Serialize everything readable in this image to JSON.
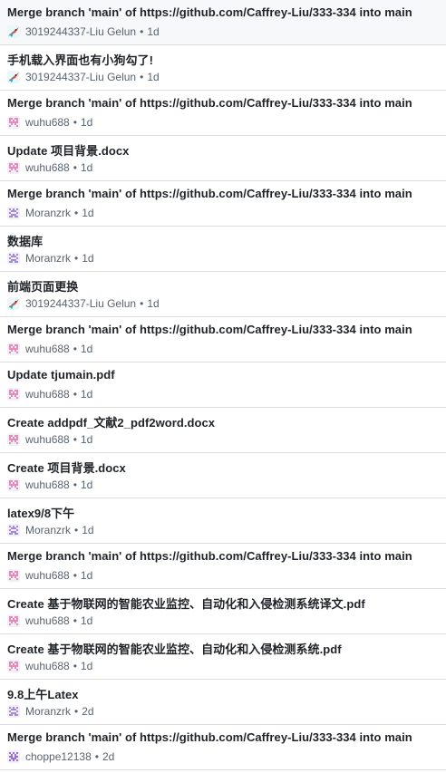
{
  "commits": [
    {
      "message": "Merge branch 'main' of https://github.com/Caffrey-Liu/333-334 into main",
      "author": "3019244337-Liu Gelun",
      "age": "1d",
      "avatar": "bird-avatar-icon",
      "sep": "•"
    },
    {
      "message": "手机载入界面也有小狗勾了!",
      "author": "3019244337-Liu Gelun",
      "age": "1d",
      "avatar": "bird-avatar-icon",
      "sep": "•"
    },
    {
      "message": "Merge branch 'main' of https://github.com/Caffrey-Liu/333-334 into main",
      "author": "wuhu688",
      "age": "1d",
      "avatar": "pink-pixel-avatar-icon",
      "sep": "•"
    },
    {
      "message": "Update 项目背景.docx",
      "author": "wuhu688",
      "age": "1d",
      "avatar": "pink-pixel-avatar-icon",
      "sep": "•"
    },
    {
      "message": "Merge branch 'main' of https://github.com/Caffrey-Liu/333-334 into main",
      "author": "Moranzrk",
      "age": "1d",
      "avatar": "purple-pixel-avatar-icon",
      "sep": "•"
    },
    {
      "message": "数据库",
      "author": "Moranzrk",
      "age": "1d",
      "avatar": "purple-pixel-avatar-icon",
      "sep": "•"
    },
    {
      "message": "前端页面更换",
      "author": "3019244337-Liu Gelun",
      "age": "1d",
      "avatar": "bird-avatar-icon",
      "sep": "•"
    },
    {
      "message": "Merge branch 'main' of https://github.com/Caffrey-Liu/333-334 into main",
      "author": "wuhu688",
      "age": "1d",
      "avatar": "pink-pixel-avatar-icon",
      "sep": "•"
    },
    {
      "message": "Update tjumain.pdf",
      "author": "wuhu688",
      "age": "1d",
      "avatar": "pink-pixel-avatar-icon",
      "sep": "•"
    },
    {
      "message": "Create addpdf_文献2_pdf2word.docx",
      "author": "wuhu688",
      "age": "1d",
      "avatar": "pink-pixel-avatar-icon",
      "sep": "•"
    },
    {
      "message": "Create 项目背景.docx",
      "author": "wuhu688",
      "age": "1d",
      "avatar": "pink-pixel-avatar-icon",
      "sep": "•"
    },
    {
      "message": "latex9/8下午",
      "author": "Moranzrk",
      "age": "1d",
      "avatar": "purple-pixel-avatar-icon",
      "sep": "•"
    },
    {
      "message": "Merge branch 'main' of https://github.com/Caffrey-Liu/333-334 into main",
      "author": "wuhu688",
      "age": "1d",
      "avatar": "pink-pixel-avatar-icon",
      "sep": "•"
    },
    {
      "message": "Create 基于物联网的智能农业监控、自动化和入侵检测系统译文.pdf",
      "author": "wuhu688",
      "age": "1d",
      "avatar": "pink-pixel-avatar-icon",
      "sep": "•"
    },
    {
      "message": "Create 基于物联网的智能农业监控、自动化和入侵检测系统.pdf",
      "author": "wuhu688",
      "age": "1d",
      "avatar": "pink-pixel-avatar-icon",
      "sep": "•"
    },
    {
      "message": "9.8上午Latex",
      "author": "Moranzrk",
      "age": "2d",
      "avatar": "purple-pixel-avatar-icon",
      "sep": "•"
    },
    {
      "message": "Merge branch 'main' of https://github.com/Caffrey-Liu/333-334 into main",
      "author": "choppe12138",
      "age": "2d",
      "avatar": "violet-pixel-avatar-icon",
      "sep": "•"
    }
  ],
  "colors": {
    "title": "#1f2328",
    "meta": "#59636e",
    "border": "#d8dee4",
    "pink_avatar": "#e58bb8",
    "purple_avatar": "#a58ad6",
    "violet_avatar": "#9a6fd4",
    "bird_red": "#e0533b",
    "bird_teal": "#2aa7b8"
  }
}
